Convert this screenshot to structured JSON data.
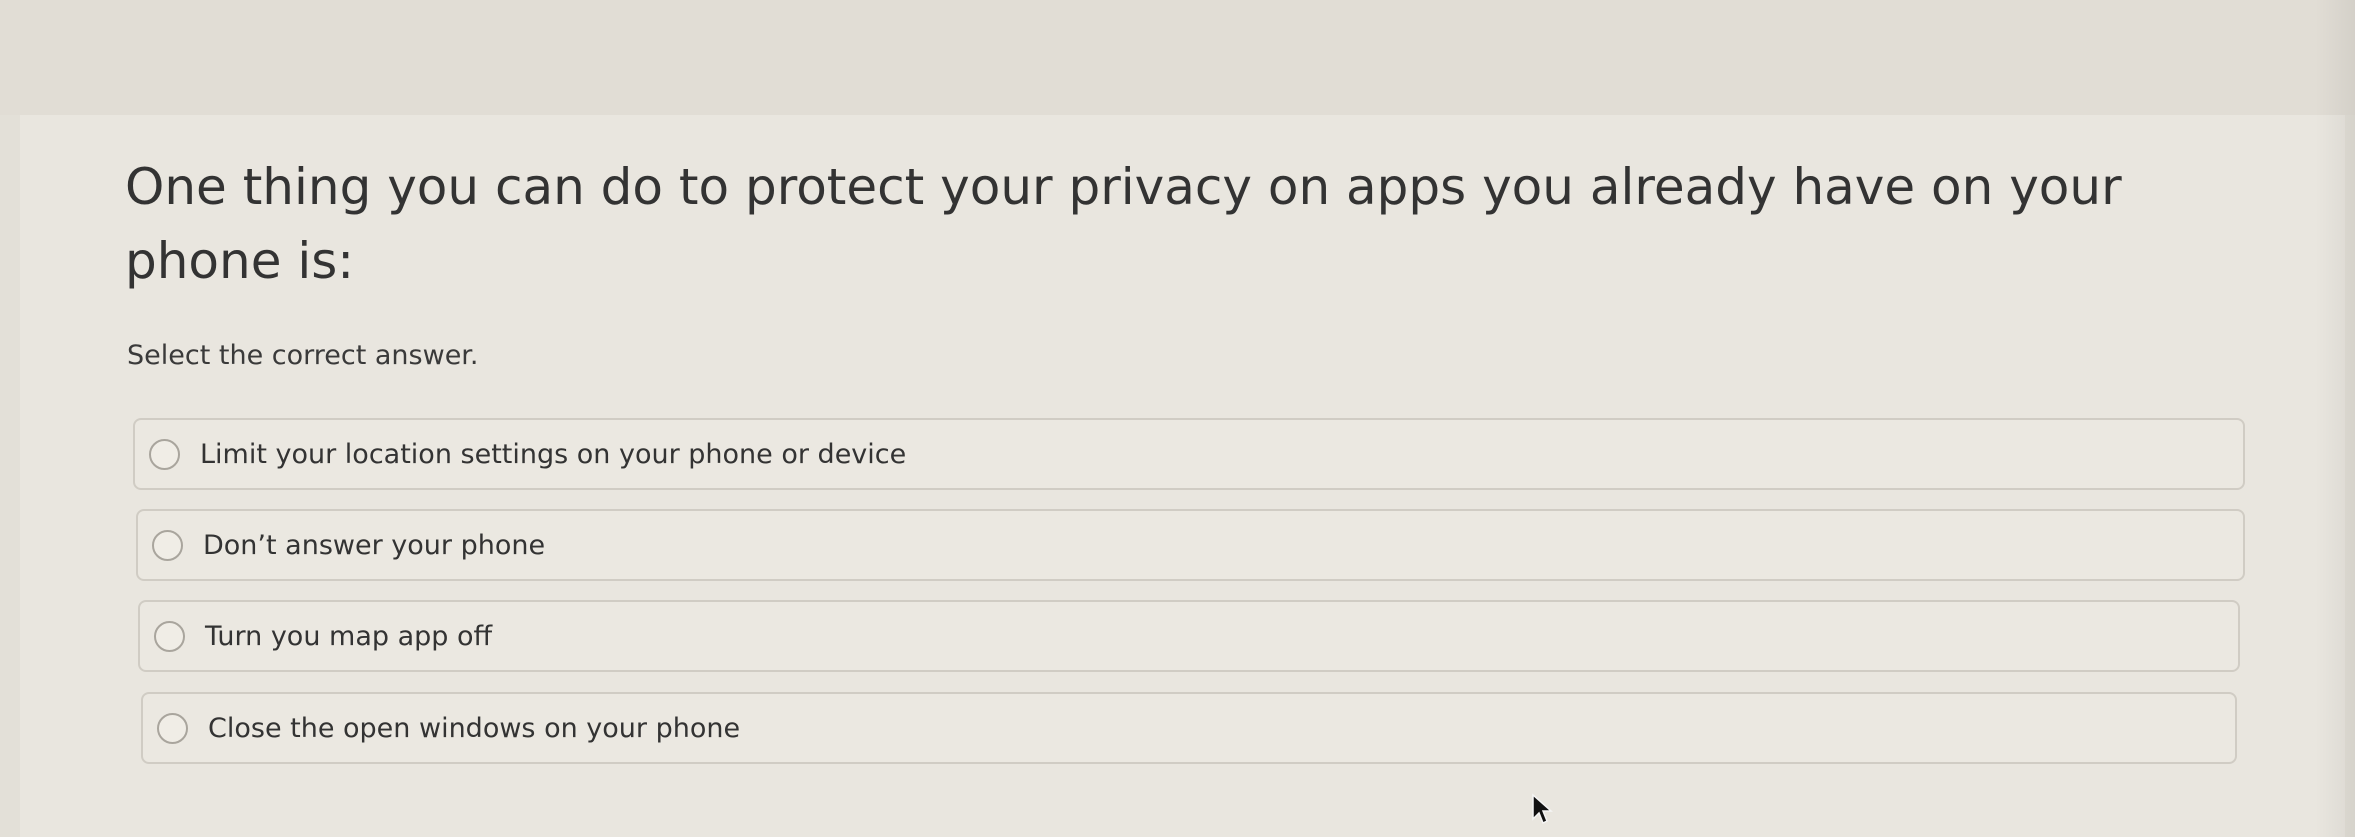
{
  "question": {
    "text": "One thing you can do to protect your privacy on apps you already have on your phone is:",
    "instruction": "Select the correct answer."
  },
  "options": [
    {
      "label": "Limit your location settings on your phone or device",
      "selected": false
    },
    {
      "label": "Don’t answer your phone",
      "selected": false
    },
    {
      "label": "Turn you map app off",
      "selected": false
    },
    {
      "label": "Close the open windows on your phone",
      "selected": false
    }
  ],
  "icons": {
    "radio": "radio-button-icon",
    "cursor": "mouse-pointer-icon"
  },
  "colors": {
    "background": "#e3e0d8",
    "card": "#e9e6df",
    "text": "#333333",
    "border": "#d0ccc4"
  }
}
